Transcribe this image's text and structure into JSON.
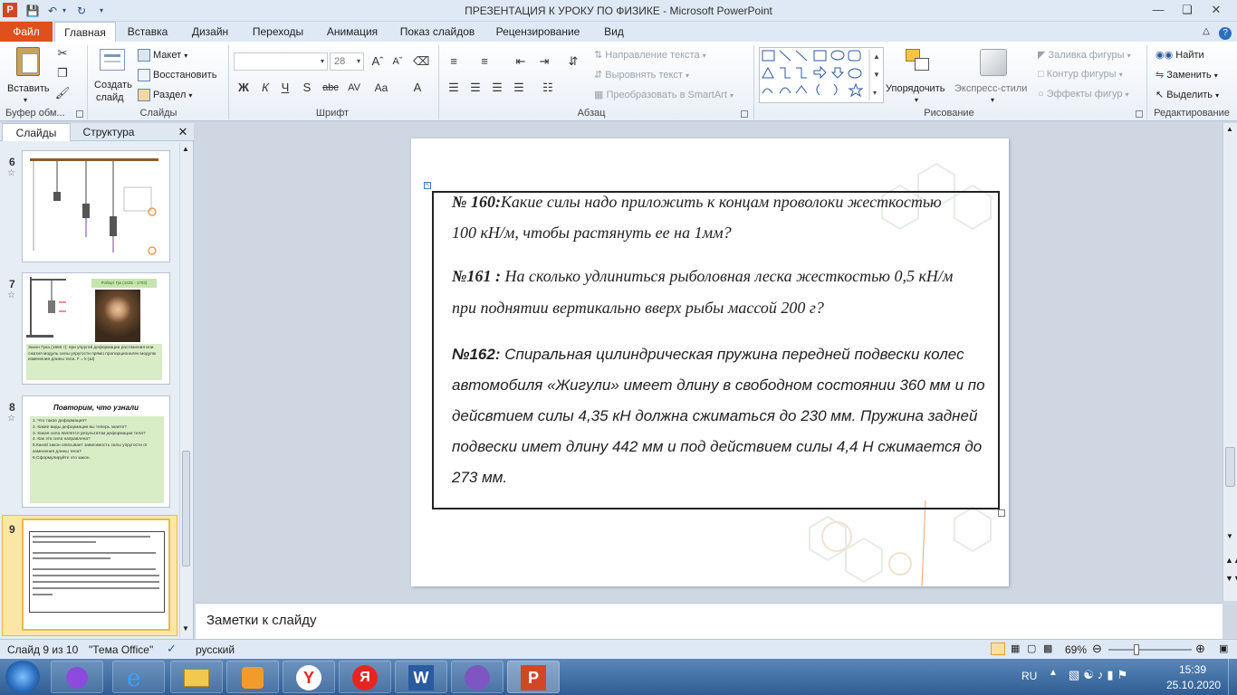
{
  "titlebar": {
    "title": "ПРЕЗЕНТАЦИЯ К УРОКУ ПО ФИЗИКЕ  -  Microsoft PowerPoint",
    "app_icon": "P"
  },
  "tabs": [
    "Файл",
    "Главная",
    "Вставка",
    "Дизайн",
    "Переходы",
    "Анимация",
    "Показ слайдов",
    "Рецензирование",
    "Вид"
  ],
  "ribbon": {
    "clipboard": {
      "paste": "Вставить",
      "label": "Буфер обм..."
    },
    "slides": {
      "new_slide_1": "Создать",
      "new_slide_2": "слайд",
      "layout": "Макет",
      "reset": "Восстановить",
      "section": "Раздел",
      "label": "Слайды"
    },
    "font": {
      "size": "28",
      "label": "Шрифт",
      "bold": "Ж",
      "italic": "К",
      "underline": "Ч",
      "shadow": "S",
      "strike": "abc",
      "spacing": "AV",
      "case": "Aa",
      "color": "A"
    },
    "paragraph": {
      "text_direction": "Направление текста",
      "align_text": "Выровнять текст",
      "smartart": "Преобразовать в SmartArt",
      "label": "Абзац"
    },
    "drawing": {
      "arrange": "Упорядочить",
      "quick_styles": "Экспресс-стили",
      "fill": "Заливка фигуры",
      "outline": "Контур фигуры",
      "effects": "Эффекты фигур",
      "label": "Рисование"
    },
    "editing": {
      "find": "Найти",
      "replace": "Заменить",
      "select": "Выделить",
      "label": "Редактирование"
    }
  },
  "pane": {
    "tab_slides": "Слайды",
    "tab_outline": "Структура"
  },
  "thumbnails": [
    {
      "num": "6"
    },
    {
      "num": "7",
      "caption": "Роберт Гук (1635 - 1703)",
      "text": "Закон Гука (1660 г): при упругой деформации растяжения или сжатия модуль силы упругости прямо пропорционален модулю изменения длины тела. F = k·|Δl|"
    },
    {
      "num": "8",
      "title": "Повторим, что узнали",
      "items": [
        "1. Что такое деформация?",
        "2. Какие виды деформации вы теперь знаете?",
        "3. Какая сила является результатом деформации тела?",
        "4. Как эта сила направлена?",
        "5.Какой закон описывает зависимость силы упругости от изменения длины тела?",
        "6.Сформулируйте это закон."
      ]
    },
    {
      "num": "9"
    }
  ],
  "slide": {
    "p160_num": "№ 160:",
    "p160_line1": "Какие силы надо приложить к концам проволоки жесткостью",
    "p160_line2": "100 кН/м, чтобы растянуть ее на  1мм?",
    "p161_num": "№161 :",
    "p161_line1": " На сколько удлиниться рыболовная леска жесткостью 0,5 кН/м",
    "p161_line2": "при поднятии вертикально вверх рыбы массой 200 г?",
    "p162_num": "№162:",
    "p162_line1": " Спиральная цилиндрическая пружина передней подвески колес",
    "p162_line2": "автомобиля «Жигули» имеет длину в свободном состоянии 360 мм и по",
    "p162_line3": "дейсвтием силы 4,35 кН должна сжиматься до 230 мм. Пружина задней",
    "p162_line4": "подвески имет длину 442 мм и под действием силы 4,4 Н сжимается до",
    "p162_line5": "273 мм."
  },
  "notes": {
    "placeholder": "Заметки к слайду"
  },
  "status": {
    "slide": "Слайд 9 из 10",
    "theme": "\"Тема Office\"",
    "lang": "русский",
    "zoom": "69%"
  },
  "taskbar": {
    "lang": "RU",
    "time": "15:39",
    "date": "25.10.2020"
  }
}
